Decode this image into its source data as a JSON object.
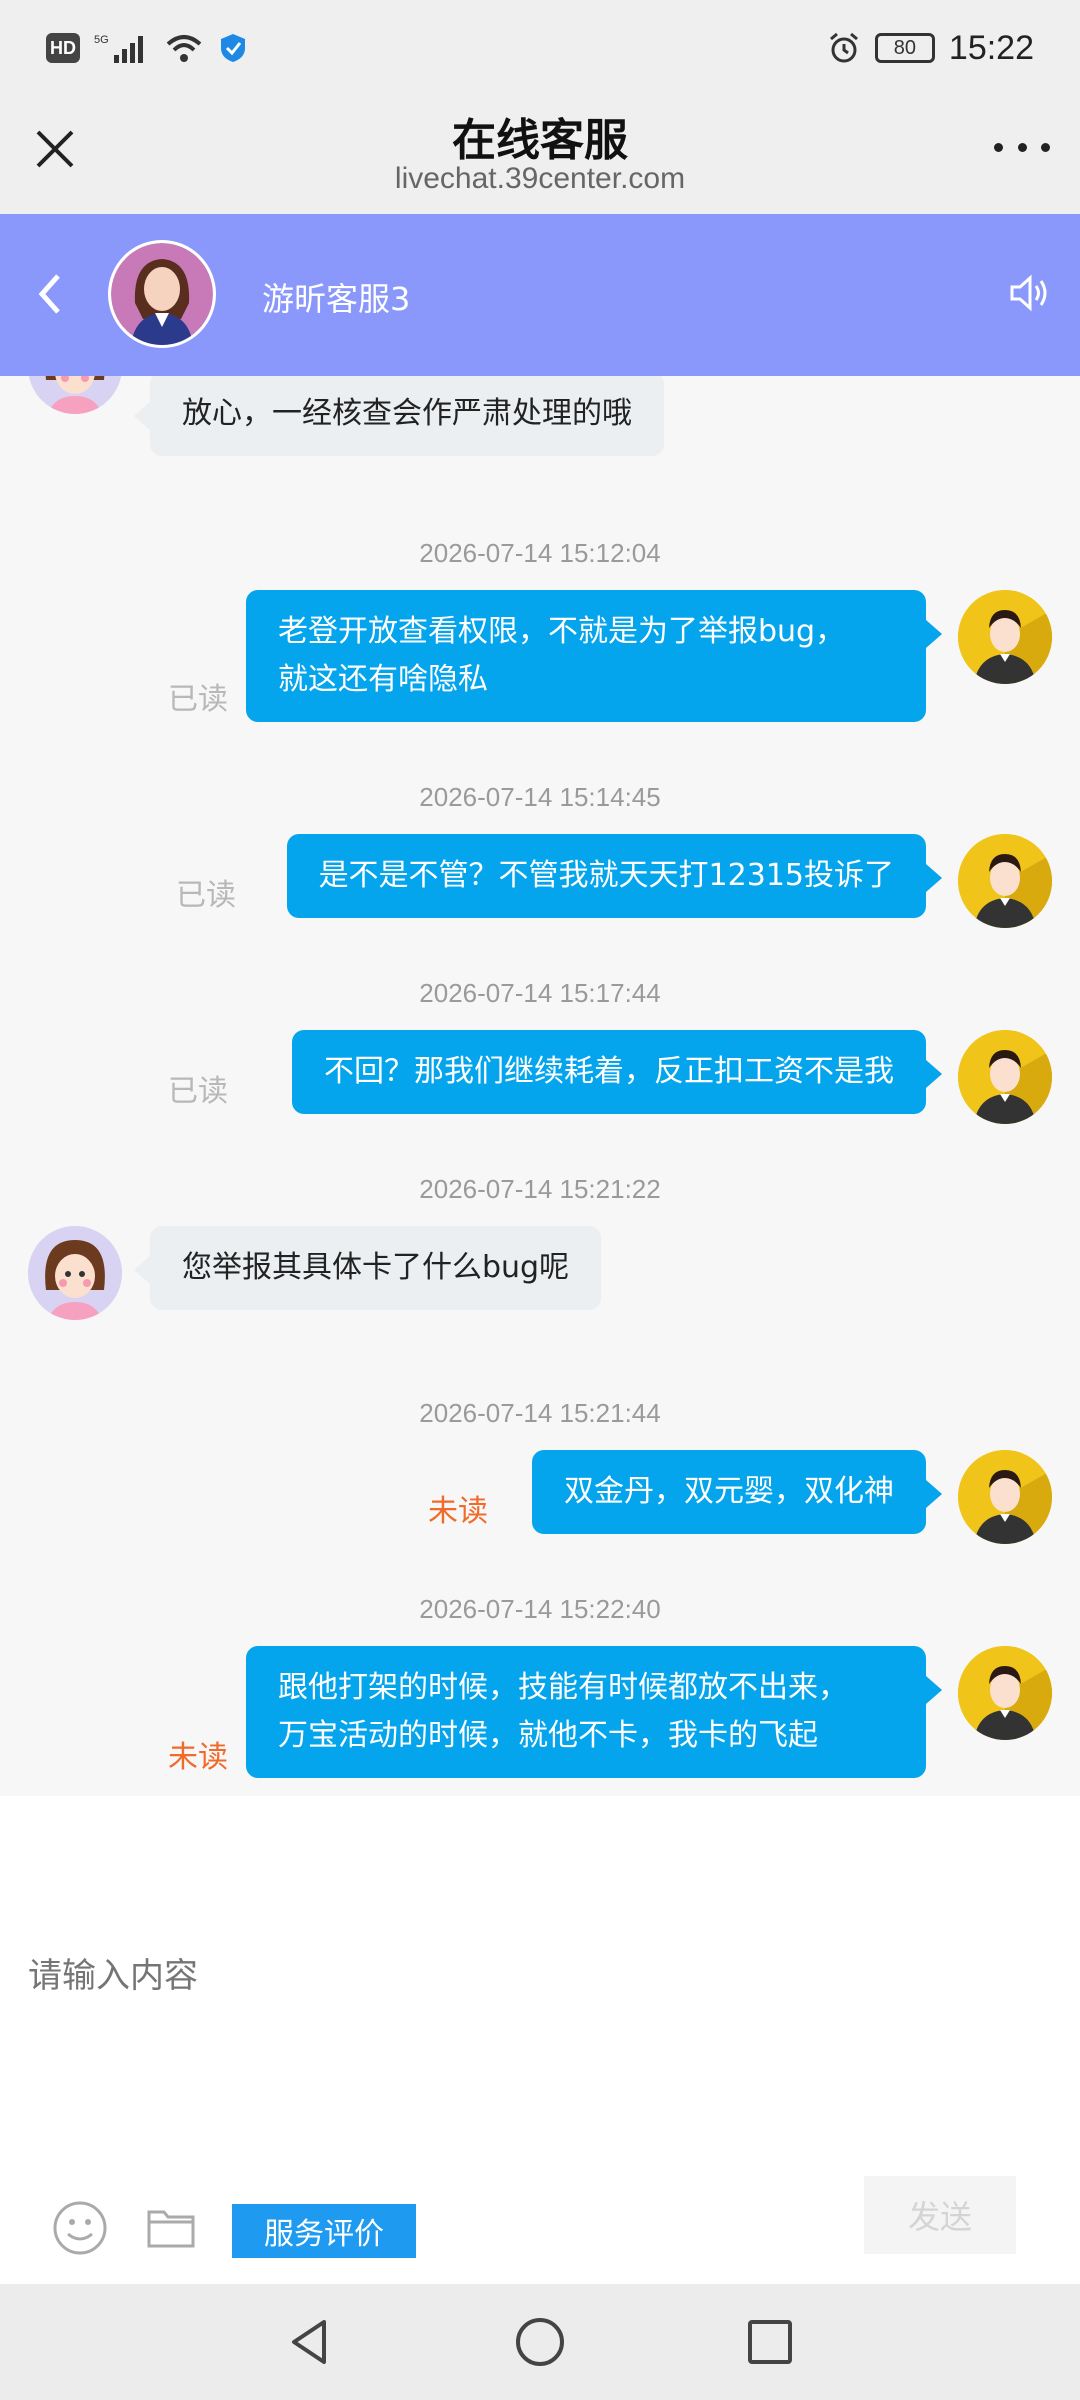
{
  "status_bar": {
    "hd": "HD",
    "network": "5G",
    "battery": "80",
    "time": "15:22"
  },
  "browser": {
    "title": "在线客服",
    "url": "livechat.39center.com"
  },
  "chat_header": {
    "agent_name": "游昕客服3",
    "color": "#8b98fb"
  },
  "messages": [
    {
      "side": "in",
      "text": "放心，一经核查会作严肃处理的哦"
    },
    {
      "timestamp": "2026-07-14 15:12:04",
      "side": "out",
      "lines": [
        "老登开放查看权限，不就是为了举报bug，",
        "就这还有啥隐私"
      ],
      "status": "已读"
    },
    {
      "timestamp": "2026-07-14 15:14:45",
      "side": "out",
      "text": "是不是不管？不管我就天天打12315投诉了",
      "status": "已读"
    },
    {
      "timestamp": "2026-07-14 15:17:44",
      "side": "out",
      "text": "不回？那我们继续耗着，反正扣工资不是我",
      "status": "已读"
    },
    {
      "timestamp": "2026-07-14 15:21:22",
      "side": "in",
      "text": "您举报其具体卡了什么bug呢"
    },
    {
      "timestamp": "2026-07-14 15:21:44",
      "side": "out",
      "text": "双金丹，双元婴，双化神",
      "status": "未读"
    },
    {
      "timestamp": "2026-07-14 15:22:40",
      "side": "out",
      "lines": [
        "跟他打架的时候，技能有时候都放不出来，",
        "万宝活动的时候，就他不卡，我卡的飞起"
      ],
      "status": "未读"
    }
  ],
  "input": {
    "placeholder": "请输入内容",
    "rating_label": "服务评价",
    "send_label": "发送"
  },
  "icons": {
    "close": "close-icon",
    "more": "more-icon",
    "back": "chevron-left-icon",
    "speaker": "speaker-icon",
    "emoji": "emoji-icon",
    "folder": "folder-icon"
  },
  "colors": {
    "user_bubble": "#04a5ec",
    "agent_bubble": "#eceff1",
    "unread": "#f06a2a",
    "read": "#b8b8b8",
    "rating_button": "#1e9af0"
  }
}
